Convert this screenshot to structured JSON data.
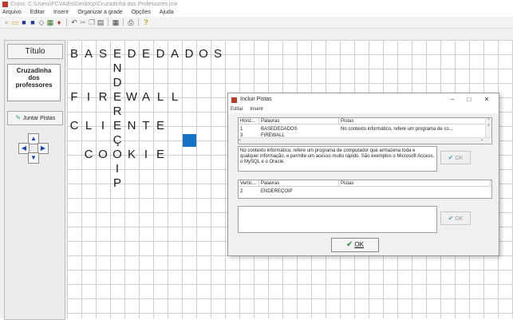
{
  "window": {
    "title": "Cross: C:\\Users\\FCVAdm\\Desktop\\Cruzadinha dos Professores.jcw"
  },
  "menu": [
    "Arquivo",
    "Editar",
    "Inserir",
    "Organizar a grade",
    "Opções",
    "Ajuda"
  ],
  "left_panel": {
    "title_button": "Título",
    "title_text": "Cruzadinha\ndos\nprofessores",
    "join_button": "Juntar Pistas"
  },
  "grid": {
    "word_basededados": [
      "B",
      "A",
      "S",
      "E",
      "D",
      "E",
      "D",
      "A",
      "D",
      "O",
      "S"
    ],
    "word_enderecoip_down": [
      "N",
      "D",
      "E",
      "R",
      "E",
      "Ç",
      "O",
      "I",
      "P"
    ],
    "word_firewall": [
      "F",
      "I",
      "R",
      "E",
      "W",
      "A",
      "L",
      "L"
    ],
    "word_cliente": [
      "C",
      "L",
      "I",
      "E",
      "N",
      "T",
      "E"
    ],
    "word_cookie": [
      "C",
      "O",
      "O",
      "K",
      "I",
      "E"
    ],
    "highlight_color": "#1473c6"
  },
  "dialog": {
    "title": "Incluir Pistas",
    "menu": [
      "Editar",
      "Inserir"
    ],
    "horizontal": {
      "headers": [
        "Horiz...",
        "Palavras",
        "Pistas"
      ],
      "rows": [
        {
          "num": "1",
          "word": "BASEDEDADOS",
          "clue": "No contexto informático, refere um programa de co..."
        },
        {
          "num": "3",
          "word": "FIREWALL",
          "clue": ""
        }
      ]
    },
    "clue_text": "No contexto informático, refere um programa de computador que armazena toda e qualquer informação, e permite um acesso muito rápido. São exemplos o Microsoft Access, o MySQL e o Oracle.",
    "ok_small": "OK",
    "vertical": {
      "headers": [
        "Vertic...",
        "Palavras",
        "Pistas"
      ],
      "rows": [
        {
          "num": "2",
          "word": "ENDEREÇOIP",
          "clue": ""
        }
      ]
    },
    "ok_main": "OK"
  }
}
